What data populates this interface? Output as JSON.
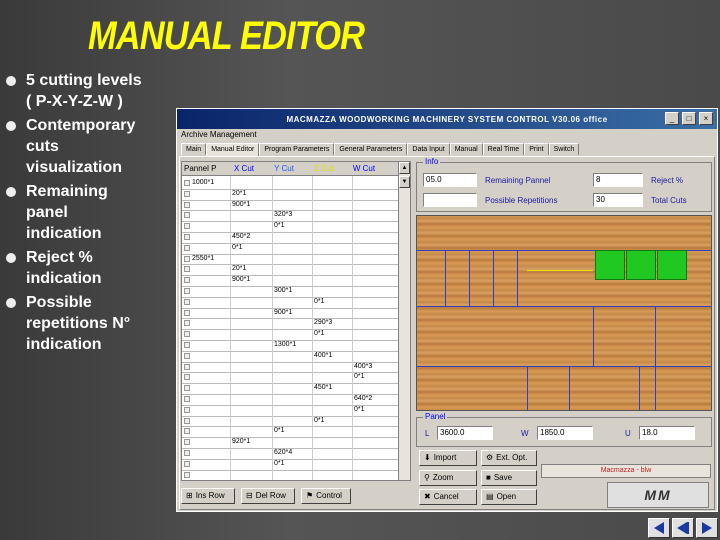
{
  "slide": {
    "title": "MANUAL EDITOR",
    "bullets": [
      "5 cutting levels\n( P-X-Y-Z-W )",
      "Contemporary\ncuts\nvisualization",
      "Remaining\npanel\nindication",
      "Reject %\nindication",
      "Possible\nrepetitions N°\nindication"
    ]
  },
  "window": {
    "title": "MACMAZZA WOODWORKING MACHINERY SYSTEM CONTROL  V30.06 office",
    "menu": "Archive Management",
    "tabs": [
      "Main",
      "Manual Editor",
      "Program Parameters",
      "General Parameters",
      "Data Input",
      "Manual",
      "Real Time",
      "Print",
      "Switch"
    ],
    "active_tab": "Manual Editor",
    "grid_headers": [
      "Pannel P",
      "X Cut",
      "Y Cut",
      "Z Cut",
      "W Cut"
    ],
    "grid_cells": [
      {
        "col": 0,
        "row": 0,
        "text": "1000*1"
      },
      {
        "col": 1,
        "row": 1,
        "text": "20*1"
      },
      {
        "col": 1,
        "row": 2,
        "text": "900*1"
      },
      {
        "col": 2,
        "row": 3,
        "text": "320*3"
      },
      {
        "col": 2,
        "row": 4,
        "text": "0*1"
      },
      {
        "col": 1,
        "row": 5,
        "text": "450*2"
      },
      {
        "col": 1,
        "row": 6,
        "text": "0*1"
      },
      {
        "col": 0,
        "row": 7,
        "text": "2550*1"
      },
      {
        "col": 1,
        "row": 8,
        "text": "20*1"
      },
      {
        "col": 1,
        "row": 9,
        "text": "900*1"
      },
      {
        "col": 2,
        "row": 10,
        "text": "300*1"
      },
      {
        "col": 3,
        "row": 11,
        "text": "0*1"
      },
      {
        "col": 2,
        "row": 12,
        "text": "900*1"
      },
      {
        "col": 3,
        "row": 13,
        "text": "290*3"
      },
      {
        "col": 3,
        "row": 14,
        "text": "0*1"
      },
      {
        "col": 2,
        "row": 15,
        "text": "1300*1"
      },
      {
        "col": 3,
        "row": 16,
        "text": "400*1"
      },
      {
        "col": 4,
        "row": 17,
        "text": "400*3"
      },
      {
        "col": 4,
        "row": 18,
        "text": "0*1"
      },
      {
        "col": 3,
        "row": 19,
        "text": "450*1"
      },
      {
        "col": 4,
        "row": 20,
        "text": "640*2"
      },
      {
        "col": 4,
        "row": 21,
        "text": "0*1"
      },
      {
        "col": 3,
        "row": 22,
        "text": "0*1"
      },
      {
        "col": 2,
        "row": 23,
        "text": "0*1"
      },
      {
        "col": 1,
        "row": 24,
        "text": "920*1"
      },
      {
        "col": 2,
        "row": 25,
        "text": "620*4"
      },
      {
        "col": 2,
        "row": 26,
        "text": "0*1"
      }
    ],
    "info": {
      "label": "Info",
      "field1": "05.0",
      "remaining_label": "Remaining Pannel",
      "remaining_value": "8",
      "reject_label": "Reject %",
      "field2": "",
      "repetitions_label": "Possible Repetitions",
      "repetitions_value": "30",
      "total_label": "Total Cuts"
    },
    "panel": {
      "label": "Panel",
      "l_label": "L",
      "l_value": "3600.0",
      "w_label": "W",
      "w_value": "1850.0",
      "u_label": "U",
      "u_value": "18.0"
    },
    "buttons": {
      "import": "Import",
      "ext_opt": "Ext. Opt.",
      "zoom": "Zoom",
      "save": "Save",
      "cancel": "Cancel",
      "open": "Open",
      "ins_row": "Ins Row",
      "del_row": "Del Row",
      "control": "Control"
    },
    "status": "Macmazza - blw",
    "logo": "MM"
  },
  "colors": {
    "title": "#ffff00",
    "wood": "#c98d4a",
    "cut_line": "#3040c0",
    "piece": "#22c822"
  }
}
